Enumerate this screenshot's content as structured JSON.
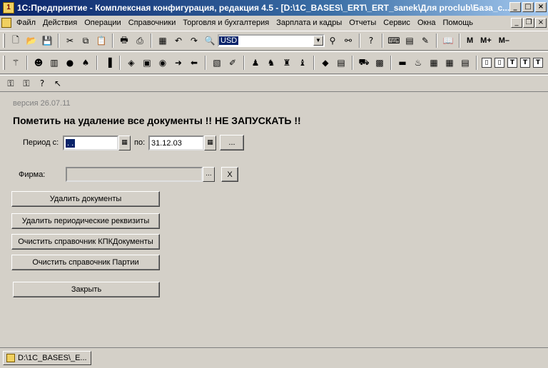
{
  "window": {
    "title": "1С:Предприятие - Комплексная конфигурация, редакция 4.5 - [D:\\1C_BASES\\_ERT\\_ERT_sanek\\Для proclub\\База_с..."
  },
  "menu": {
    "items": [
      "Файл",
      "Действия",
      "Операции",
      "Справочники",
      "Торговля и бухгалтерия",
      "Зарплата и кадры",
      "Отчеты",
      "Сервис",
      "Окна",
      "Помощь"
    ]
  },
  "toolbar": {
    "currency": "USD",
    "m_labels": [
      "M",
      "M+",
      "M–"
    ]
  },
  "form": {
    "version": "версия 26.07.11",
    "heading": "Пометить на удаление все документы !!   НЕ ЗАПУСКАТЬ !!",
    "period_from_label": "Период с:",
    "period_from_value": ". .",
    "period_to_label": "по:",
    "period_to_value": "31.12.03",
    "ellipsis": "...",
    "firm_label": "Фирма:",
    "firm_value": "",
    "clear_symbol": "X",
    "buttons": {
      "delete_docs": "Удалить документы",
      "delete_periodic": "Удалить периодические реквизиты",
      "clear_kpk": "Очистить справочник КПКДокументы",
      "clear_batches": "Очистить справочник Партии",
      "close": "Закрыть"
    }
  },
  "taskbar": {
    "item": "D:\\1C_BASES\\_E..."
  }
}
